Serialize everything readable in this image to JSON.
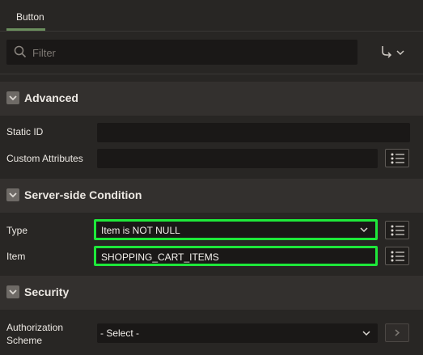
{
  "tab": {
    "label": "Button"
  },
  "filter": {
    "placeholder": "Filter"
  },
  "sections": {
    "advanced": {
      "title": "Advanced",
      "static_id_label": "Static ID",
      "custom_attributes_label": "Custom Attributes"
    },
    "server_side_condition": {
      "title": "Server-side Condition",
      "type_label": "Type",
      "type_value": "Item is NOT NULL",
      "item_label": "Item",
      "item_value": "SHOPPING_CART_ITEMS"
    },
    "security": {
      "title": "Security",
      "authorization_label_line1": "Authorization",
      "authorization_label_line2": "Scheme",
      "authorization_value": "- Select -"
    }
  },
  "colors": {
    "accent_tab": "#6b8f5e",
    "highlight": "#1ee83a",
    "background": "#282624"
  },
  "icons": [
    "search-icon",
    "menu-arrow-icon",
    "chevron-down-icon",
    "list-icon",
    "chevron-right-icon"
  ]
}
